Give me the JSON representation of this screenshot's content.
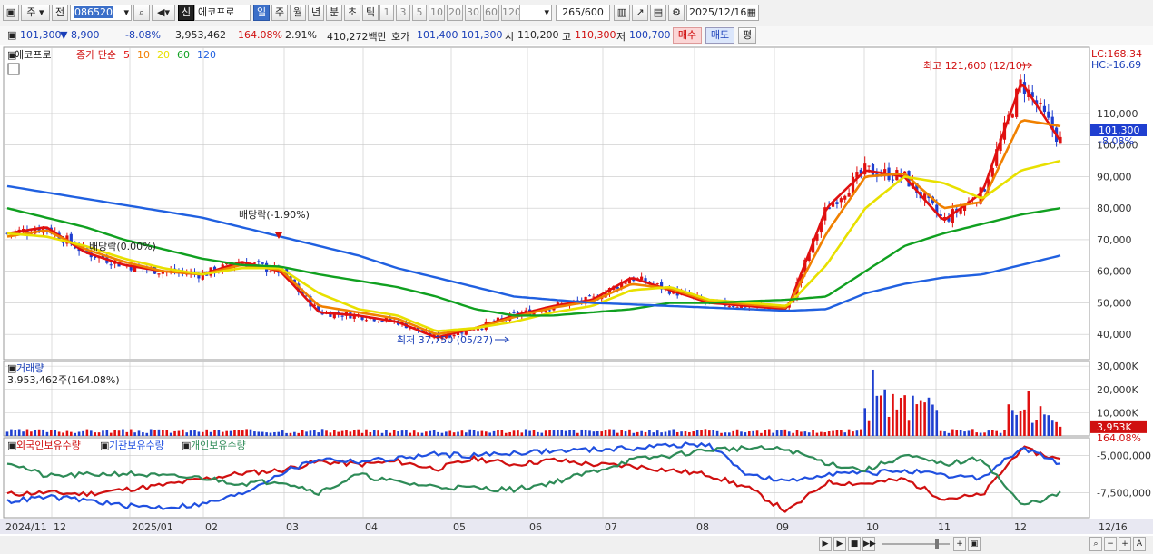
{
  "toolbar": {
    "market_label": "주",
    "prev_label": "전",
    "stock_code": "086520",
    "credit_badge": "신",
    "stock_name": "에코프로",
    "periods": [
      "일",
      "주",
      "월",
      "년",
      "분",
      "초",
      "틱"
    ],
    "active_period": "일",
    "intervals": [
      "1",
      "3",
      "5",
      "10",
      "20",
      "30",
      "60",
      "120"
    ],
    "count": "265",
    "count_max": "/600",
    "date": "2025/12/16"
  },
  "quote": {
    "price": "101,300",
    "change": "▼ 8,900",
    "change_pct": "-8.08%",
    "volume": "3,953,462",
    "volume_ratio": "164.08%",
    "turnover": "2.91%",
    "amount": "410,272백만",
    "bid_label": "호가",
    "bid_ask": "101,400 101,300",
    "open_label": "시",
    "open": "110,200",
    "high_label": "고",
    "high": "110,300",
    "low_label": "저",
    "low": "100,700",
    "buy_label": "매수",
    "sell_label": "매도",
    "avg_label": "평"
  },
  "legend": {
    "name": "에코프로",
    "title": "종가 단순",
    "ma": [
      {
        "label": "5",
        "color": "#e01010"
      },
      {
        "label": "10",
        "color": "#f08000"
      },
      {
        "label": "20",
        "color": "#e8e000"
      },
      {
        "label": "60",
        "color": "#10a020"
      },
      {
        "label": "120",
        "color": "#2060e0"
      }
    ]
  },
  "annotations": {
    "high": "최고 121,600 (12/10)",
    "low": "최저 37,750 (05/27)",
    "dividend1": "배당락(-1.90%)",
    "dividend2": "배당락(0.00%)",
    "lc": "LC:168.34",
    "hc": "HC:-16.69",
    "last_price": "101,300",
    "last_pct": "-8.08%"
  },
  "volume_panel": {
    "title": "거래량",
    "value": "3,953,462주(164.08%)",
    "last": "3,953K",
    "last_pct": "164.08%"
  },
  "holdings_panel": {
    "series": [
      {
        "name": "외국인보유수량",
        "color": "#d01010"
      },
      {
        "name": "기관보유수량",
        "color": "#2050e0"
      },
      {
        "name": "개인보유수량",
        "color": "#2e8b57"
      }
    ]
  },
  "colors": {
    "up": "#e01010",
    "down": "#1f3fd0",
    "grid": "#c8c8c8"
  },
  "chart_data": [
    {
      "type": "candlestick",
      "title": "에코프로",
      "x": [
        "2024/11",
        "12",
        "2025/01",
        "02",
        "03",
        "04",
        "05",
        "06",
        "07",
        "08",
        "09",
        "10",
        "11",
        "12",
        "12/16"
      ],
      "y_ticks": [
        "40,000",
        "50,000",
        "60,000",
        "70,000",
        "80,000",
        "90,000",
        "100,000",
        "110,000"
      ],
      "ylim": [
        32000,
        131000
      ],
      "series": [
        {
          "name": "5",
          "values": [
            72000,
            74000,
            66000,
            62000,
            60000,
            59000,
            63000,
            60000,
            47000,
            46000,
            44000,
            39000,
            42000,
            46000,
            49000,
            51000,
            58000,
            54000,
            50000,
            49000,
            48000,
            80000,
            92000,
            90000,
            76000,
            85000,
            120000,
            101300
          ]
        },
        {
          "name": "10",
          "values": [
            71000,
            73000,
            67000,
            63000,
            60000,
            59000,
            62000,
            60500,
            49000,
            47000,
            45000,
            40000,
            42000,
            45500,
            48500,
            50500,
            56000,
            54500,
            50500,
            49500,
            48500,
            72000,
            90000,
            91000,
            80000,
            82000,
            108000,
            106000
          ]
        },
        {
          "name": "20",
          "values": [
            72000,
            71000,
            68000,
            64000,
            61000,
            59000,
            61000,
            61000,
            53000,
            48000,
            46000,
            41000,
            42000,
            44000,
            47000,
            49000,
            54000,
            55000,
            51000,
            50000,
            49000,
            62000,
            80000,
            90000,
            88000,
            83000,
            92000,
            95000
          ]
        },
        {
          "name": "60",
          "values": [
            80000,
            77000,
            74000,
            70000,
            67000,
            64000,
            62000,
            61500,
            59000,
            57000,
            55000,
            52000,
            48000,
            46000,
            46000,
            47000,
            48000,
            50000,
            50000,
            50500,
            51000,
            52000,
            60000,
            68000,
            72000,
            75000,
            78000,
            80000
          ]
        },
        {
          "name": "120",
          "values": [
            87000,
            85000,
            83000,
            81000,
            79000,
            77000,
            74000,
            71000,
            68000,
            65000,
            61000,
            58000,
            55000,
            52000,
            51000,
            50000,
            49500,
            49000,
            48500,
            48000,
            47500,
            48000,
            53000,
            56000,
            58000,
            59000,
            62000,
            65000
          ]
        }
      ],
      "high": 121600,
      "high_date": "12/10",
      "low": 37750,
      "low_date": "05/27",
      "last": 101300,
      "last_change_pct": -8.08
    },
    {
      "type": "bar",
      "title": "거래량",
      "y_ticks": [
        "10,000K",
        "20,000K",
        "30,000K"
      ],
      "ylim": [
        0,
        32000
      ],
      "last": 3953
    },
    {
      "type": "line",
      "title": "보유수량",
      "y_ticks": [
        "-5,000,000",
        "-7,500,000"
      ],
      "series": [
        {
          "name": "외국인보유수량",
          "values": [
            -7.6,
            -7.5,
            -7.6,
            -7.3,
            -7.0,
            -6.6,
            -6.2,
            -6.0,
            -5.4,
            -5.6,
            -5.4,
            -5.9,
            -5.2,
            -5.6,
            -5.3,
            -5.6,
            -5.7,
            -6.0,
            -6.3,
            -7.2,
            -8.8,
            -6.8,
            -6.9,
            -6.6,
            -7.9,
            -7.7,
            -4.5,
            -5.3
          ]
        },
        {
          "name": "기관보유수량",
          "values": [
            -8.1,
            -7.8,
            -8.0,
            -8.4,
            -8.5,
            -8.3,
            -7.6,
            -6.2,
            -5.2,
            -5.4,
            -5.2,
            -4.9,
            -5.0,
            -4.8,
            -4.7,
            -4.6,
            -4.5,
            -4.3,
            -4.3,
            -6.3,
            -6.8,
            -6.2,
            -6.2,
            -6.0,
            -6.4,
            -6.5,
            -4.5,
            -5.5
          ]
        },
        {
          "name": "개인보유수량",
          "values": [
            -5.4,
            -6.4,
            -6.3,
            -6.2,
            -6.4,
            -6.5,
            -6.9,
            -6.7,
            -7.5,
            -6.3,
            -6.8,
            -7.1,
            -7.2,
            -7.3,
            -6.8,
            -6.1,
            -5.3,
            -5.0,
            -4.6,
            -4.5,
            -4.6,
            -5.5,
            -6.0,
            -5.0,
            -5.6,
            -5.2,
            -8.4,
            -7.6
          ]
        }
      ]
    }
  ]
}
